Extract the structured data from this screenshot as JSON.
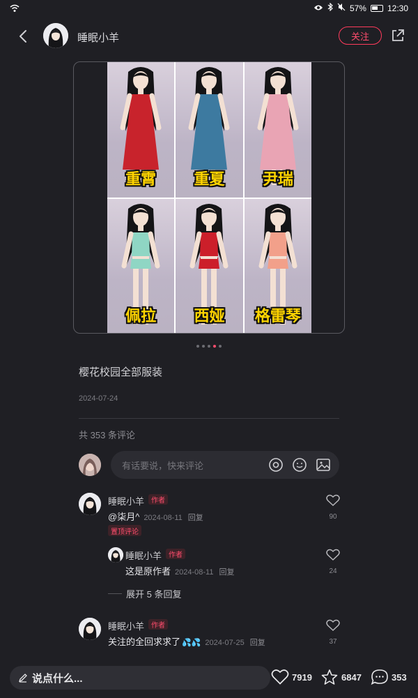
{
  "status_bar": {
    "battery": "57%",
    "time": "12:30"
  },
  "header": {
    "author_name": "睡眠小羊",
    "follow_label": "关注"
  },
  "gallery": {
    "captions": [
      "重霄",
      "重夏",
      "尹瑞",
      "佩拉",
      "西娅",
      "格雷琴"
    ],
    "outfit_colors": [
      "#c8232c",
      "#3d7aa0",
      "#e9a4b4",
      "#8fd6c4",
      "#cc1f2a",
      "#f2a08a"
    ],
    "page_count": 5,
    "active_page": 4
  },
  "post": {
    "title": "樱花校园全部服装",
    "date": "2024-07-24",
    "comment_count_text": "共 353 条评论"
  },
  "comment_input": {
    "placeholder": "有话要说，快来评论"
  },
  "comments": [
    {
      "name": "睡眠小羊",
      "tag": "作者",
      "text": "@柒月^",
      "date": "2024-08-11",
      "reply_label": "回复",
      "pin_label": "置顶评论",
      "likes": "90",
      "replies": [
        {
          "name": "睡眠小羊",
          "tag": "作者",
          "text": "这是原作者",
          "date": "2024-08-11",
          "reply_label": "回复",
          "likes": "24"
        }
      ],
      "expand_label": "展开 5 条回复"
    },
    {
      "name": "睡眠小羊",
      "tag": "作者",
      "text": "关注的全回求求了",
      "date": "2024-07-25",
      "reply_label": "回复",
      "likes": "37"
    }
  ],
  "bottom_bar": {
    "say_label": "说点什么...",
    "likes": "7919",
    "stars": "6847",
    "comments": "353"
  },
  "colors": {
    "accent": "#ff4d6d",
    "background": "#1f1f24"
  }
}
